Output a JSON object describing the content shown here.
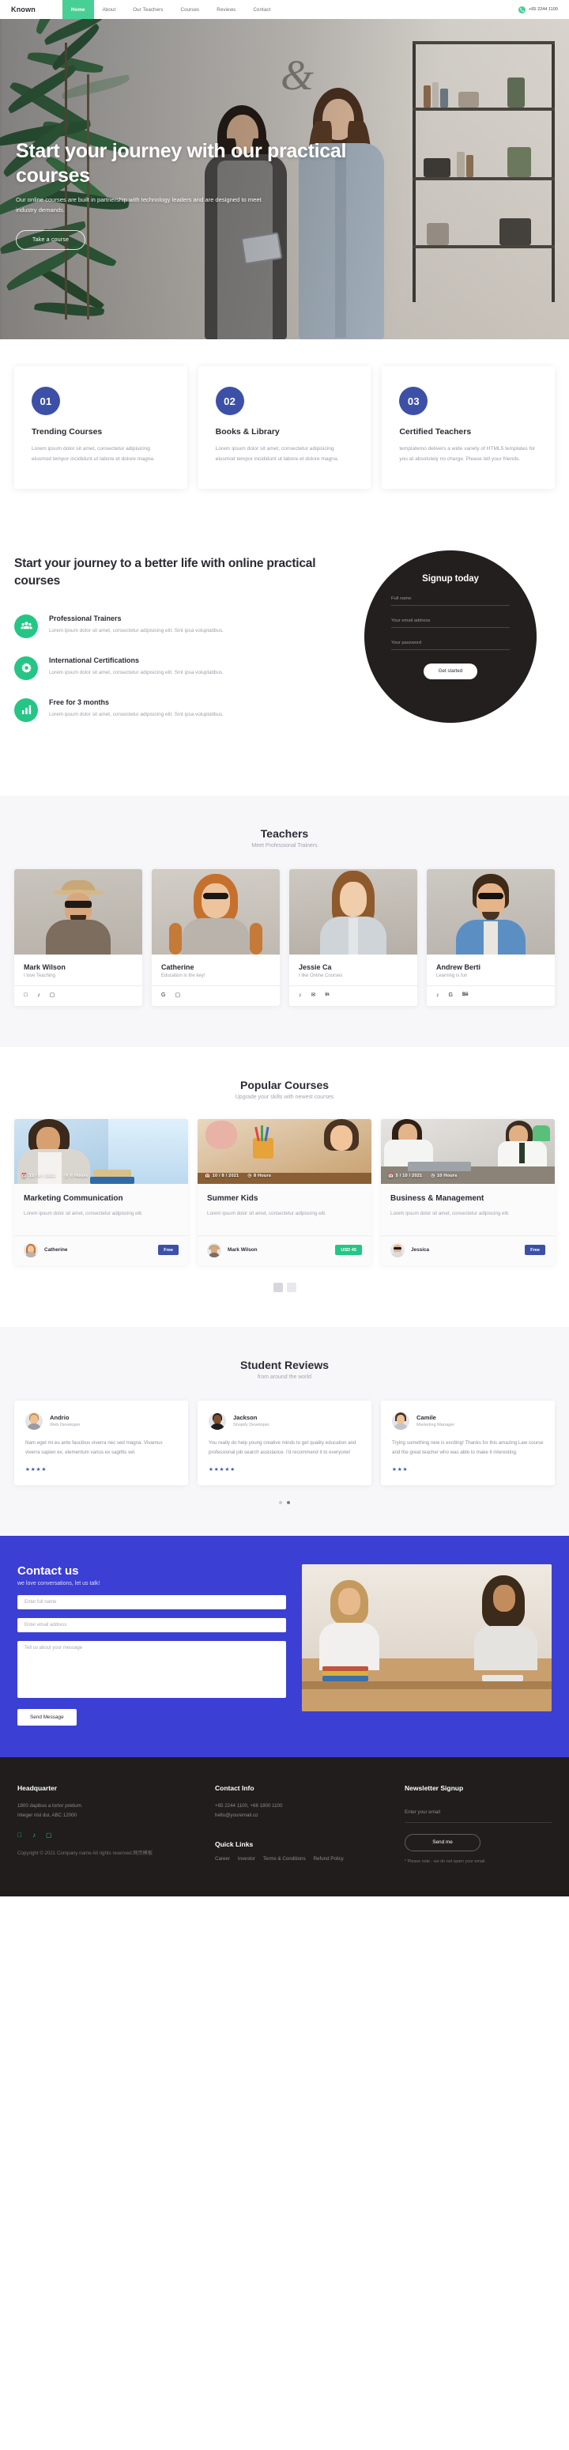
{
  "brand": "Known",
  "nav": {
    "items": [
      {
        "label": "Home",
        "active": true
      },
      {
        "label": "About",
        "active": false
      },
      {
        "label": "Our Teachers",
        "active": false
      },
      {
        "label": "Courses",
        "active": false
      },
      {
        "label": "Reviews",
        "active": false
      },
      {
        "label": "Contact",
        "active": false
      }
    ],
    "phone": "+65 2244 1100",
    "accent": "#48cf95"
  },
  "hero": {
    "title": "Start your journey with our practical courses",
    "subtitle": "Our online courses are built in partnership with technology leaders and are designed to meet industry demands.",
    "button": "Take a course"
  },
  "features": [
    {
      "num": "01",
      "title": "Trending Courses",
      "text": "Lorem ipsum dolor sit amet, consectetur adipisicing eiusmod tempor incididunt ut labore et dolore magna."
    },
    {
      "num": "02",
      "title": "Books & Library",
      "text": "Lorem ipsum dolor sit amet, consectetur adipisicing eiusmod tempor incididunt ut labore et dolore magna."
    },
    {
      "num": "03",
      "title": "Certified Teachers",
      "text": "templatemo delivers a wide variety of HTML5 templates for you at absolutely no charge. Please tell your friends."
    }
  ],
  "journey": {
    "heading": "Start your journey to a better life with online practical courses",
    "items": [
      {
        "title": "Professional Trainers",
        "text": "Lorem ipsum dolor sit amet, consectetur adipisicing elit. Sint ipsa voluptatibus.",
        "icon": "users-icon"
      },
      {
        "title": "International Certifications",
        "text": "Lorem ipsum dolor sit amet, consectetur adipisicing elit. Sint ipsa voluptatibus.",
        "icon": "gear-icon"
      },
      {
        "title": "Free for 3 months",
        "text": "Lorem ipsum dolor sit amet, consectetur adipisicing elit. Sint ipsa voluptatibus.",
        "icon": "chart-icon"
      }
    ]
  },
  "signup": {
    "title": "Signup today",
    "name_placeholder": "Full name",
    "email_placeholder": "Your email address",
    "password_placeholder": "Your password",
    "button": "Get started"
  },
  "teachers_section": {
    "title": "Teachers",
    "subtitle": "Meet Professional Trainers"
  },
  "teachers": [
    {
      "name": "Mark Wilson",
      "role": "I love Teaching",
      "socials": [
        "facebook-icon",
        "twitter-icon",
        "instagram-icon"
      ]
    },
    {
      "name": "Catherine",
      "role": "Education is the key!",
      "socials": [
        "google-icon",
        "instagram-icon"
      ]
    },
    {
      "name": "Jessie Ca",
      "role": "I like Online Courses",
      "socials": [
        "twitter-icon",
        "email-icon",
        "linkedin-icon"
      ]
    },
    {
      "name": "Andrew Berti",
      "role": "Learning is fun",
      "socials": [
        "twitter-icon",
        "google-icon",
        "behance-icon"
      ]
    }
  ],
  "courses_section": {
    "title": "Popular Courses",
    "subtitle": "Upgrade your skills with newest courses"
  },
  "courses": [
    {
      "date": "15 / 8 / 2021",
      "duration": "6 Hours",
      "title": "Marketing Communication",
      "text": "Lorem ipsum dolor sit amet, consectetur adipiscing elit.",
      "author": "Catherine",
      "price": "Free",
      "price_color": "#3c50a8"
    },
    {
      "date": "10 / 8 / 2021",
      "duration": "8 Hours",
      "title": "Summer Kids",
      "text": "Lorem ipsum dolor sit amet, consectetur adipiscing elit.",
      "author": "Mark Wilson",
      "price": "USD 45",
      "price_color": "#25c685"
    },
    {
      "date": "5 / 10 / 2021",
      "duration": "10 Hours",
      "title": "Business & Management",
      "text": "Lorem ipsum dolor sit amet, consectetur adipiscing elit.",
      "author": "Jessica",
      "price": "Free",
      "price_color": "#3c50a8"
    }
  ],
  "reviews_section": {
    "title": "Student Reviews",
    "subtitle": "from around the world"
  },
  "reviews": [
    {
      "name": "Andrio",
      "role": "Web Developer",
      "text": "Nam eget mi eu ante faucibus viverra nec sed magna. Vivamus viverra sapien ex, elementum varius ex sagittis vel.",
      "stars": "★★★★"
    },
    {
      "name": "Jackson",
      "role": "Shopify Developer",
      "text": "You really do help young creative minds to get quality education and professional job search assistance. I'd recommend it to everyone!",
      "stars": "★★★★★"
    },
    {
      "name": "Camile",
      "role": "Marketing Manager",
      "text": "Trying something new is exciting! Thanks for this amazing Law course and the great teacher who was able to make it interesting.",
      "stars": "★★★"
    }
  ],
  "contact": {
    "title": "Contact us",
    "subtitle": "we love conversations, let us talk!",
    "name_placeholder": "Enter full name",
    "email_placeholder": "Enter email address",
    "message_placeholder": "Tell us about your message",
    "button": "Send Message"
  },
  "footer": {
    "headquarter": {
      "title": "Headquarter",
      "line1": "1800 dapibus a tortor pretium.",
      "line2": "Integer nisl dui, ABC 12000",
      "socials": [
        "facebook-icon",
        "twitter-icon",
        "instagram-icon"
      ],
      "copyright": "Copyright © 2021 Company name All rights reserved.网页模板"
    },
    "contact_info": {
      "title": "Contact Info",
      "phone": "+65 2244 1100, +66 1800 1100",
      "email": "hello@youremail.co"
    },
    "quick_links": {
      "title": "Quick Links",
      "links": [
        "Career",
        "Investor",
        "Terms & Conditions",
        "Refund Policy"
      ]
    },
    "newsletter": {
      "title": "Newsletter Signup",
      "placeholder": "Enter your email",
      "button": "Send me",
      "note": "* Please note - we do not spam your email."
    }
  }
}
